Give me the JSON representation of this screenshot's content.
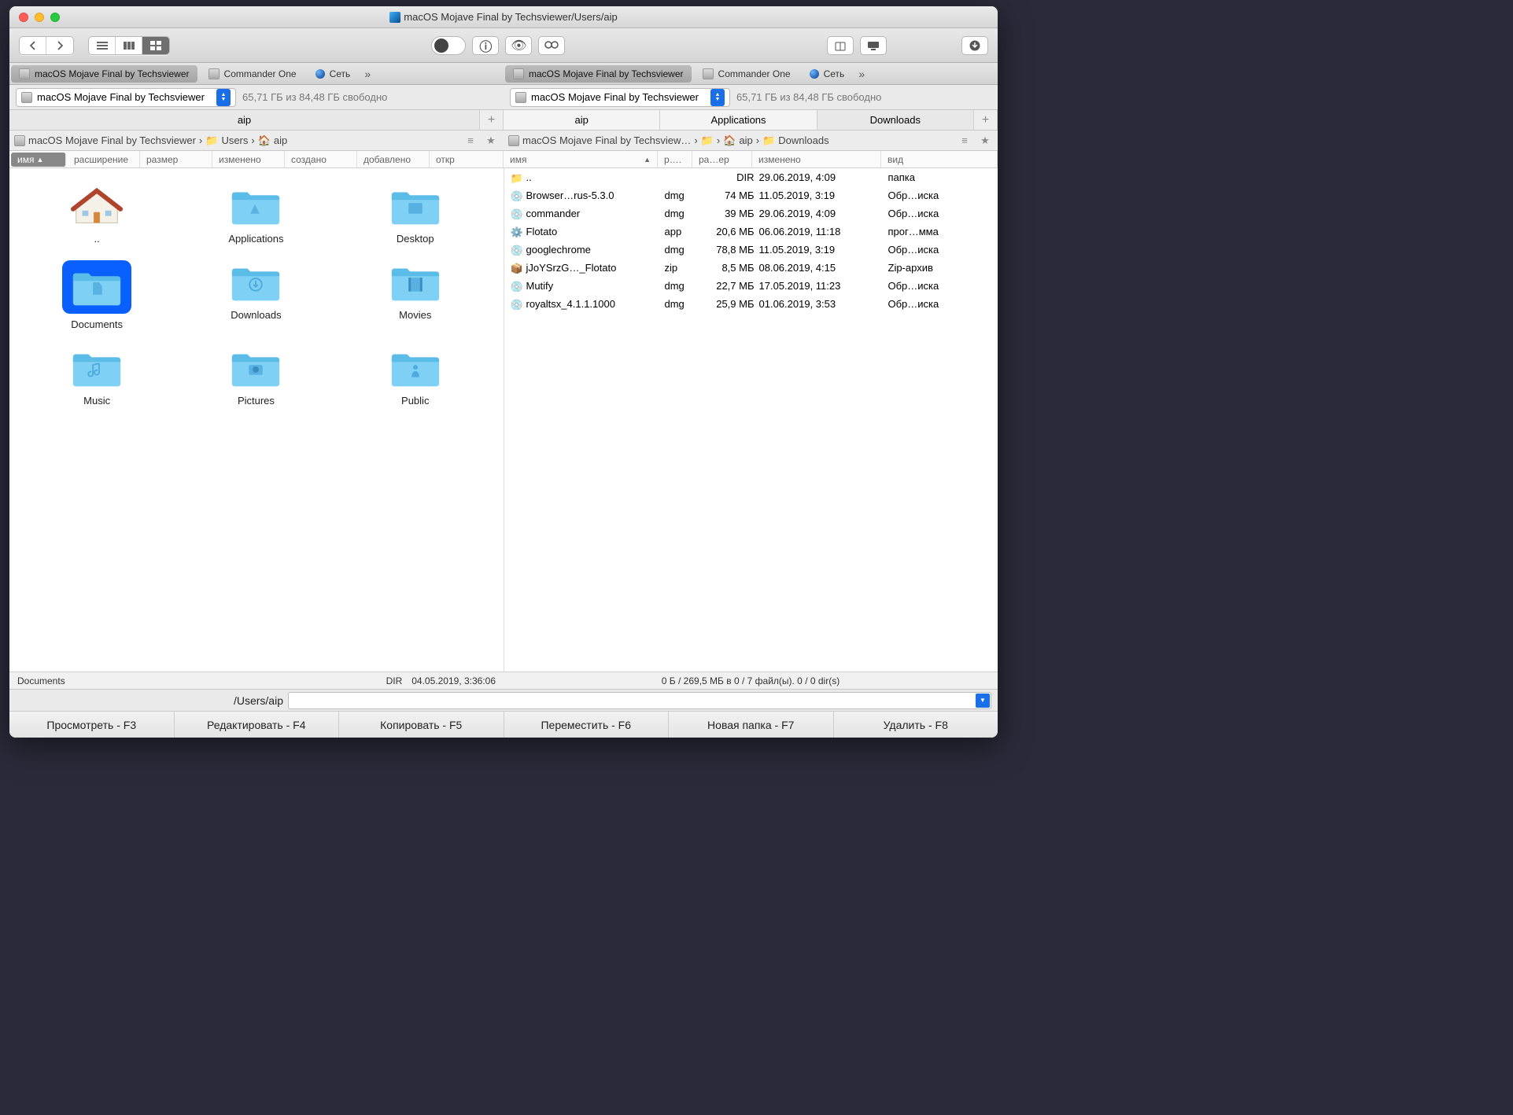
{
  "title": "macOS Mojave Final by Techsviewer/Users/aip",
  "volume": {
    "label": "macOS Mojave Final by Techsviewer",
    "free": "65,71 ГБ из 84,48 ГБ свободно"
  },
  "apptabs": [
    {
      "label": "macOS Mojave Final by Techsviewer",
      "active": true,
      "icon": "hd"
    },
    {
      "label": "Commander One",
      "active": false,
      "icon": "hd"
    },
    {
      "label": "Сеть",
      "active": false,
      "icon": "net"
    }
  ],
  "left": {
    "paneltab": "aip",
    "crumbs": [
      {
        "label": "macOS Mojave Final by Techsviewer",
        "icon": "hd"
      },
      {
        "label": "Users",
        "icon": "folder"
      },
      {
        "label": "aip",
        "icon": "home"
      }
    ],
    "headers": [
      "имя",
      "расширение",
      "размер",
      "изменено",
      "создано",
      "добавлено",
      "откр"
    ],
    "items": [
      {
        "name": "..",
        "kind": "up"
      },
      {
        "name": "Applications",
        "kind": "apps"
      },
      {
        "name": "Desktop",
        "kind": "desktop"
      },
      {
        "name": "Documents",
        "kind": "docs",
        "selected": true
      },
      {
        "name": "Downloads",
        "kind": "downloads"
      },
      {
        "name": "Movies",
        "kind": "movies"
      },
      {
        "name": "Music",
        "kind": "music"
      },
      {
        "name": "Pictures",
        "kind": "pictures"
      },
      {
        "name": "Public",
        "kind": "public"
      }
    ],
    "status": {
      "name": "Documents",
      "type": "DIR",
      "date": "04.05.2019, 3:36:06"
    }
  },
  "right": {
    "paneltabs": [
      {
        "label": "aip",
        "active": false
      },
      {
        "label": "Applications",
        "active": false
      },
      {
        "label": "Downloads",
        "active": true
      }
    ],
    "crumbs": [
      {
        "label": "macOS Mojave Final by Techsview…",
        "icon": "hd"
      },
      {
        "label": "",
        "icon": "folder"
      },
      {
        "label": "aip",
        "icon": "home"
      },
      {
        "label": "Downloads",
        "icon": "dl"
      }
    ],
    "headers": {
      "name": "имя",
      "ext": "р….",
      "size": "ра…ер",
      "date": "изменено",
      "kind": "вид"
    },
    "rows": [
      {
        "name": "..",
        "ext": "",
        "size": "DIR",
        "date": "29.06.2019, 4:09",
        "kind": "папка",
        "icon": "up"
      },
      {
        "name": "Browser…rus-5.3.0",
        "ext": "dmg",
        "size": "74 МБ",
        "date": "11.05.2019, 3:19",
        "kind": "Обр…иска",
        "icon": "dmg"
      },
      {
        "name": "commander",
        "ext": "dmg",
        "size": "39 МБ",
        "date": "29.06.2019, 4:09",
        "kind": "Обр…иска",
        "icon": "dmg"
      },
      {
        "name": "Flotato",
        "ext": "app",
        "size": "20,6 МБ",
        "date": "06.06.2019, 11:18",
        "kind": "прог…мма",
        "icon": "app"
      },
      {
        "name": "googlechrome",
        "ext": "dmg",
        "size": "78,8 МБ",
        "date": "11.05.2019, 3:19",
        "kind": "Обр…иска",
        "icon": "dmg"
      },
      {
        "name": "jJoYSrzG…_Flotato",
        "ext": "zip",
        "size": "8,5 МБ",
        "date": "08.06.2019, 4:15",
        "kind": "Zip-архив",
        "icon": "zip"
      },
      {
        "name": "Mutify",
        "ext": "dmg",
        "size": "22,7 МБ",
        "date": "17.05.2019, 11:23",
        "kind": "Обр…иска",
        "icon": "dmg"
      },
      {
        "name": "royaltsx_4.1.1.1000",
        "ext": "dmg",
        "size": "25,9 МБ",
        "date": "01.06.2019, 3:53",
        "kind": "Обр…иска",
        "icon": "dmg"
      }
    ],
    "status": "0 Б / 269,5 МБ в 0 / 7 файл(ы). 0 / 0 dir(s)"
  },
  "path": "/Users/aip",
  "fkeys": [
    "Просмотреть - F3",
    "Редактировать - F4",
    "Копировать - F5",
    "Переместить - F6",
    "Новая папка - F7",
    "Удалить - F8"
  ]
}
